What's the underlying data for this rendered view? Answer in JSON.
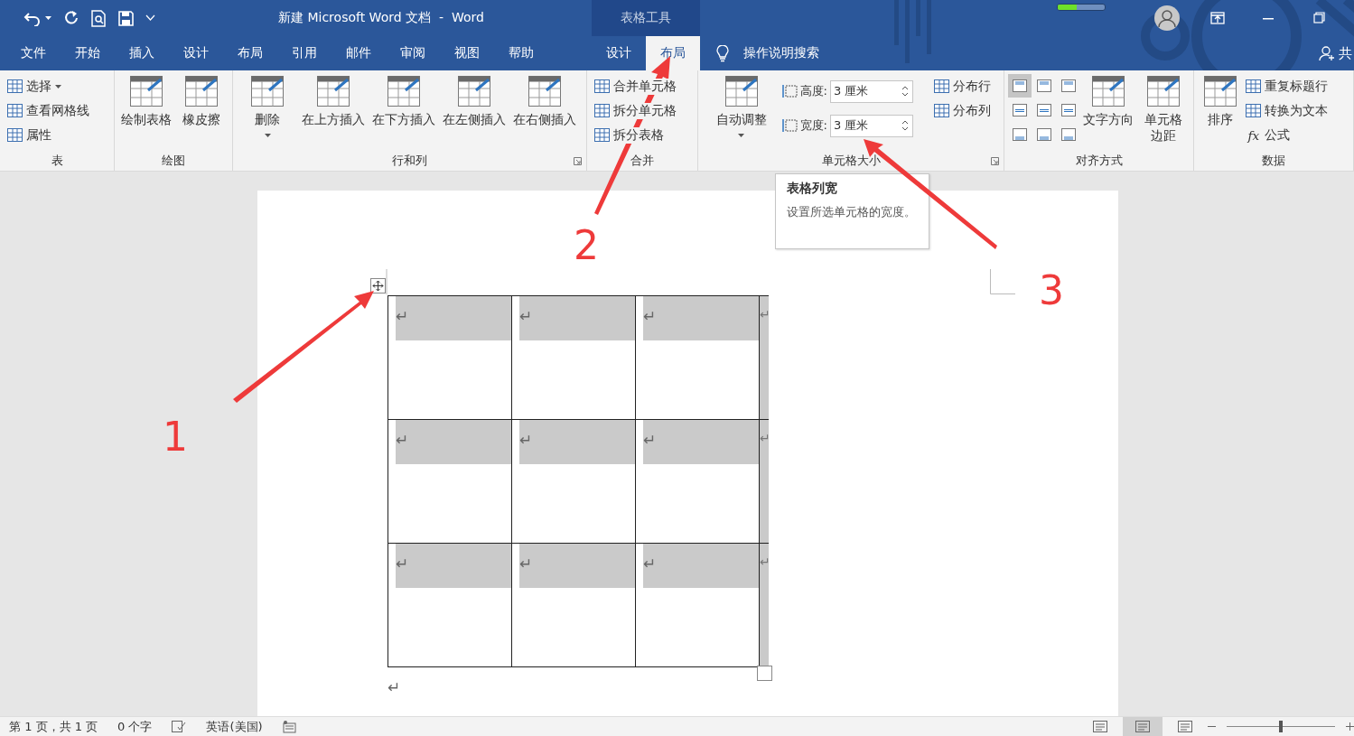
{
  "window": {
    "title": "新建 Microsoft Word 文档  -  Word",
    "context_group": "表格工具"
  },
  "tabs": [
    {
      "label": "文件",
      "selected": false,
      "kind": "normal"
    },
    {
      "label": "开始",
      "selected": false,
      "kind": "normal"
    },
    {
      "label": "插入",
      "selected": false,
      "kind": "normal"
    },
    {
      "label": "设计",
      "selected": false,
      "kind": "normal"
    },
    {
      "label": "布局",
      "selected": false,
      "kind": "normal"
    },
    {
      "label": "引用",
      "selected": false,
      "kind": "normal"
    },
    {
      "label": "邮件",
      "selected": false,
      "kind": "normal"
    },
    {
      "label": "审阅",
      "selected": false,
      "kind": "normal"
    },
    {
      "label": "视图",
      "selected": false,
      "kind": "normal"
    },
    {
      "label": "帮助",
      "selected": false,
      "kind": "normal"
    },
    {
      "label": "设计",
      "selected": false,
      "kind": "context"
    },
    {
      "label": "布局",
      "selected": true,
      "kind": "context"
    }
  ],
  "tell_me": "操作说明搜索",
  "share": "共",
  "ribbon_groups": [
    {
      "label": "表",
      "launcher": false,
      "columns": [
        [
          {
            "kind": "small",
            "label": "选择",
            "dropdown": true
          },
          {
            "kind": "small",
            "label": "查看网格线",
            "dropdown": false
          },
          {
            "kind": "small",
            "label": "属性",
            "dropdown": false
          }
        ]
      ]
    },
    {
      "label": "绘图",
      "launcher": false,
      "columns": [
        [
          {
            "kind": "large",
            "label": "绘制表格",
            "dropdown": false
          }
        ],
        [
          {
            "kind": "large",
            "label": "橡皮擦",
            "dropdown": false
          }
        ]
      ]
    },
    {
      "label": "行和列",
      "launcher": true,
      "columns": [
        [
          {
            "kind": "large",
            "label": "删除",
            "dropdown": true
          }
        ],
        [
          {
            "kind": "large",
            "label": "在上方插入",
            "dropdown": false
          }
        ],
        [
          {
            "kind": "large",
            "label": "在下方插入",
            "dropdown": false
          }
        ],
        [
          {
            "kind": "large",
            "label": "在左侧插入",
            "dropdown": false
          }
        ],
        [
          {
            "kind": "large",
            "label": "在右侧插入",
            "dropdown": false
          }
        ]
      ]
    },
    {
      "label": "合并",
      "launcher": false,
      "columns": [
        [
          {
            "kind": "small",
            "label": "合并单元格",
            "dropdown": false
          },
          {
            "kind": "small",
            "label": "拆分单元格",
            "dropdown": false
          },
          {
            "kind": "small",
            "label": "拆分表格",
            "dropdown": false
          }
        ]
      ]
    },
    {
      "label": "单元格大小",
      "launcher": true,
      "columns": [
        [
          {
            "kind": "large",
            "label": "自动调整",
            "dropdown": true
          }
        ],
        [
          {
            "kind": "spin",
            "label": "高度:",
            "value": "3 厘米"
          },
          {
            "kind": "spin",
            "label": "宽度:",
            "value": "3 厘米"
          }
        ],
        [
          {
            "kind": "small",
            "label": "分布行",
            "dropdown": false
          },
          {
            "kind": "small",
            "label": "分布列",
            "dropdown": false
          }
        ]
      ]
    },
    {
      "label": "对齐方式",
      "launcher": false,
      "columns": [
        [
          {
            "kind": "align-grid",
            "cells": [
              {
                "selected": true
              },
              {
                "selected": false
              },
              {
                "selected": false
              },
              {
                "selected": false
              },
              {
                "selected": false
              },
              {
                "selected": false
              },
              {
                "selected": false
              },
              {
                "selected": false
              },
              {
                "selected": false
              }
            ]
          }
        ],
        [
          {
            "kind": "large",
            "label": "文字方向",
            "dropdown": false
          }
        ],
        [
          {
            "kind": "large",
            "label": "单元格边距",
            "dropdown": false
          }
        ]
      ]
    },
    {
      "label": "数据",
      "launcher": false,
      "columns": [
        [
          {
            "kind": "large",
            "label": "排序",
            "dropdown": false
          }
        ],
        [
          {
            "kind": "small",
            "label": "重复标题行",
            "dropdown": false
          },
          {
            "kind": "small",
            "label": "转换为文本",
            "dropdown": false
          },
          {
            "kind": "small",
            "label": "公式",
            "dropdown": false,
            "icon_text": "fx"
          }
        ]
      ]
    }
  ],
  "tooltip": {
    "title": "表格列宽",
    "text": "设置所选单元格的宽度。"
  },
  "table": {
    "rows": [
      [
        "↵",
        "↵",
        "↵"
      ],
      [
        "↵",
        "↵",
        "↵"
      ],
      [
        "↵",
        "↵",
        "↵"
      ]
    ],
    "row_end_marks": [
      "↵",
      "↵",
      "↵"
    ],
    "after_mark": "↵"
  },
  "annotations": [
    "1",
    "2",
    "3"
  ],
  "sync_progress": {
    "level": 0.4
  },
  "status_bar": {
    "page": "第 1 页，共 1 页",
    "words": "0 个字",
    "language": "英语(美国)",
    "views": [
      {
        "selected": false
      },
      {
        "selected": true
      },
      {
        "selected": false
      }
    ],
    "zoom": {
      "level": 0.5
    }
  }
}
